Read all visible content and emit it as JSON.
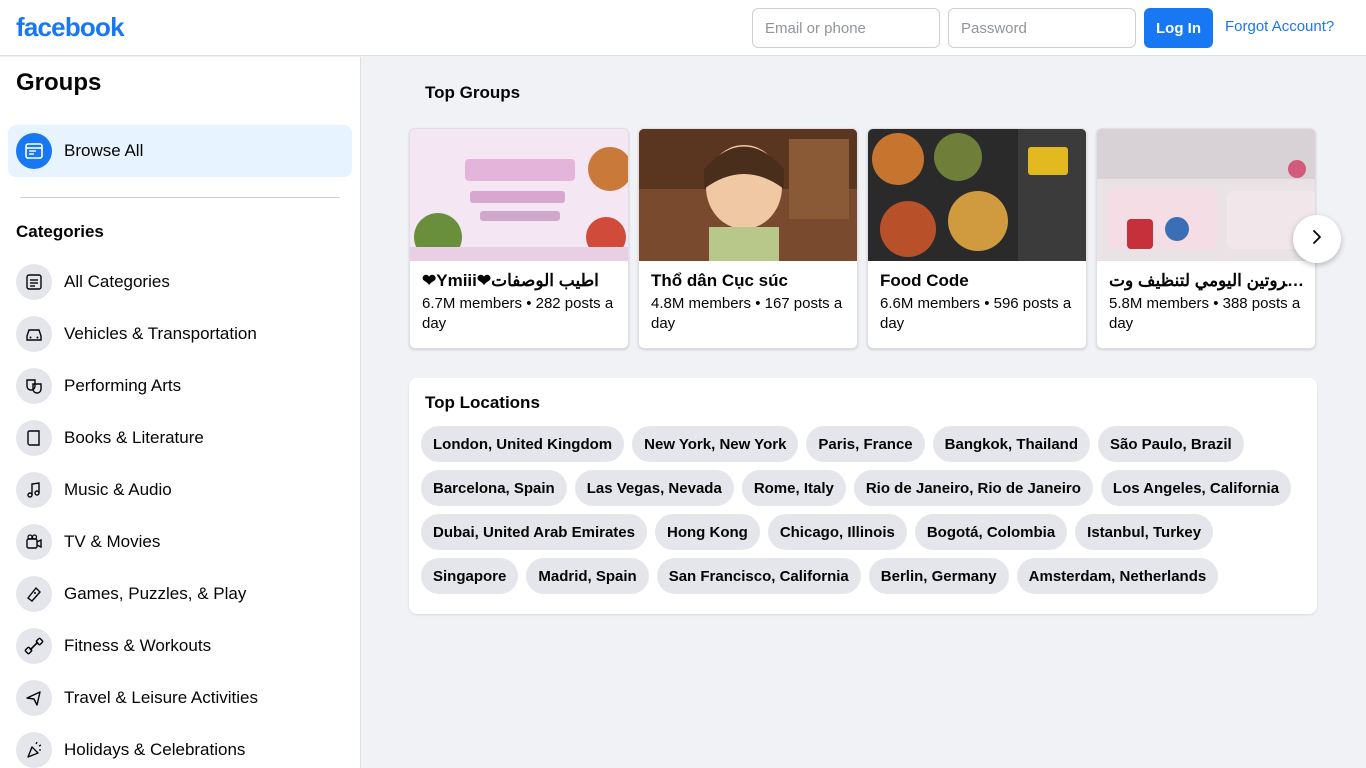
{
  "header": {
    "logo": "facebook",
    "email_placeholder": "Email or phone",
    "password_placeholder": "Password",
    "login_label": "Log In",
    "forgot_label": "Forgot Account?"
  },
  "sidebar": {
    "title": "Groups",
    "browse_all": "Browse All",
    "categories_title": "Categories",
    "categories": [
      {
        "label": "All Categories",
        "icon": "list-icon"
      },
      {
        "label": "Vehicles & Transportation",
        "icon": "car-icon"
      },
      {
        "label": "Performing Arts",
        "icon": "theater-masks-icon"
      },
      {
        "label": "Books & Literature",
        "icon": "book-icon"
      },
      {
        "label": "Music & Audio",
        "icon": "music-note-icon"
      },
      {
        "label": "TV & Movies",
        "icon": "video-camera-icon"
      },
      {
        "label": "Games, Puzzles, & Play",
        "icon": "game-controller-icon"
      },
      {
        "label": "Fitness & Workouts",
        "icon": "dumbbell-icon"
      },
      {
        "label": "Travel & Leisure Activities",
        "icon": "airplane-icon"
      },
      {
        "label": "Holidays & Celebrations",
        "icon": "party-icon"
      }
    ]
  },
  "top_groups": {
    "title": "Top Groups",
    "groups": [
      {
        "name": "❤Ymiii❤اطيب الوصفات",
        "meta": "6.7M members • 282 posts a day"
      },
      {
        "name": "Thổ dân Cục súc",
        "meta": "4.8M members • 167 posts a day"
      },
      {
        "name": "Food Code",
        "meta": "6.6M members • 596 posts a day"
      },
      {
        "name": "الروتين اليومي لتنظيف وت...",
        "meta": "5.8M members • 388 posts a day"
      }
    ]
  },
  "top_locations": {
    "title": "Top Locations",
    "items": [
      "London, United Kingdom",
      "New York, New York",
      "Paris, France",
      "Bangkok, Thailand",
      "São Paulo, Brazil",
      "Barcelona, Spain",
      "Las Vegas, Nevada",
      "Rome, Italy",
      "Rio de Janeiro, Rio de Janeiro",
      "Los Angeles, California",
      "Dubai, United Arab Emirates",
      "Hong Kong",
      "Chicago, Illinois",
      "Bogotá, Colombia",
      "Istanbul, Turkey",
      "Singapore",
      "Madrid, Spain",
      "San Francisco, California",
      "Berlin, Germany",
      "Amsterdam, Netherlands"
    ]
  },
  "colors": {
    "brand": "#1877f2",
    "background": "#f0f2f5",
    "chip": "#e4e6eb",
    "selected": "#e7f3ff"
  }
}
